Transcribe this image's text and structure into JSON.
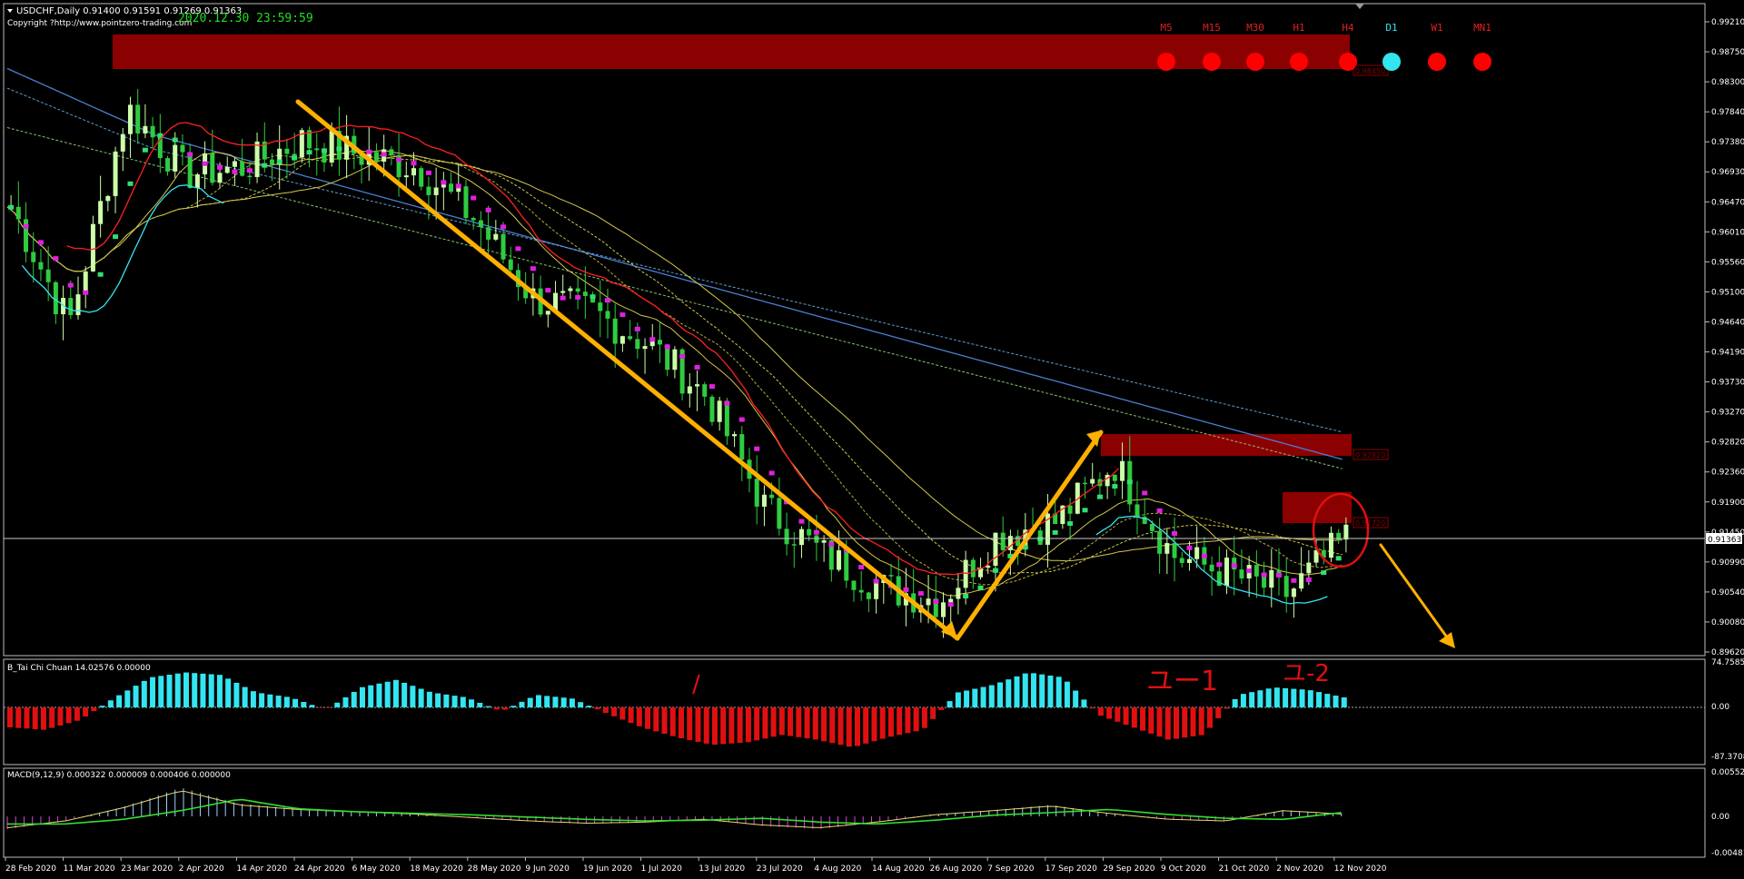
{
  "header": {
    "symbol_line": "USDCHF,Daily  0.91400 0.91591 0.91269 0.91363",
    "copyright": "Copyright ?http://www.pointzero-trading.com",
    "timestamp": "2020.12.30 23:59:59"
  },
  "timeframes": [
    {
      "label": "M5",
      "color": "#ff0000"
    },
    {
      "label": "M15",
      "color": "#ff0000"
    },
    {
      "label": "M30",
      "color": "#ff0000"
    },
    {
      "label": "H1",
      "color": "#ff0000"
    },
    {
      "label": "H4",
      "color": "#ff0000"
    },
    {
      "label": "D1",
      "color": "#33e5f0"
    },
    {
      "label": "W1",
      "color": "#ff0000"
    },
    {
      "label": "MN1",
      "color": "#ff0000"
    }
  ],
  "main_axis": {
    "ticks": [
      "0.99210",
      "0.98750",
      "0.98300",
      "0.97840",
      "0.97380",
      "0.96930",
      "0.96470",
      "0.96010",
      "0.95560",
      "0.95100",
      "0.94640",
      "0.94190",
      "0.93730",
      "0.93270",
      "0.92820",
      "0.92360",
      "0.91900",
      "0.91450",
      "0.90990",
      "0.90540",
      "0.90080",
      "0.89620"
    ],
    "current_price": "0.91363"
  },
  "box_labels": [
    "0.92820",
    "0.91720",
    "0.98450"
  ],
  "dates": [
    "28 Feb 2020",
    "11 Mar 2020",
    "23 Mar 2020",
    "2 Apr 2020",
    "14 Apr 2020",
    "24 Apr 2020",
    "6 May 2020",
    "18 May 2020",
    "28 May 2020",
    "9 Jun 2020",
    "19 Jun 2020",
    "1 Jul 2020",
    "13 Jul 2020",
    "23 Jul 2020",
    "4 Aug 2020",
    "14 Aug 2020",
    "26 Aug 2020",
    "7 Sep 2020",
    "17 Sep 2020",
    "29 Sep 2020",
    "9 Oct 2020",
    "21 Oct 2020",
    "2 Nov 2020",
    "12 Nov 2020"
  ],
  "indicator1": {
    "title": "B_Tai Chi Chuan 14.02576 0.00000",
    "ticks": [
      "74.75856",
      "0.00",
      "-87.37081"
    ],
    "annotations": [
      "/",
      "ユー1",
      "ユ-2"
    ]
  },
  "indicator2": {
    "title": "MACD(9,12,9) 0.000322 0.000009 0.000406 0.000000",
    "ticks": [
      "0.005528",
      "0.00",
      "-0.004814"
    ]
  },
  "colors": {
    "background": "#000000",
    "bull_candle": "#ccffaa",
    "bear_candle": "#2ecc40",
    "supply_zone": "#8b0000",
    "arrow": "#ffb000",
    "ma_blue": "#4a7fd0",
    "ma_yellow": "#d4c84a",
    "magenta": "#e020e0",
    "cyan": "#33e5f0",
    "hist_pos": "#33e5f0",
    "hist_neg": "#e01010"
  },
  "chart_data": [
    {
      "type": "candlestick",
      "title": "USDCHF,Daily",
      "ylim": [
        0.8962,
        0.9921
      ],
      "x": [
        "28 Feb 2020",
        "11 Mar 2020",
        "23 Mar 2020",
        "2 Apr 2020",
        "14 Apr 2020",
        "24 Apr 2020",
        "6 May 2020",
        "18 May 2020",
        "28 May 2020",
        "9 Jun 2020",
        "19 Jun 2020",
        "1 Jul 2020",
        "13 Jul 2020",
        "23 Jul 2020",
        "4 Aug 2020",
        "14 Aug 2020",
        "26 Aug 2020",
        "7 Sep 2020",
        "17 Sep 2020",
        "29 Sep 2020",
        "9 Oct 2020",
        "21 Oct 2020",
        "2 Nov 2020",
        "12 Nov 2020"
      ],
      "close_approx": [
        0.964,
        0.946,
        0.979,
        0.969,
        0.97,
        0.974,
        0.972,
        0.97,
        0.962,
        0.95,
        0.948,
        0.943,
        0.935,
        0.918,
        0.911,
        0.906,
        0.904,
        0.914,
        0.916,
        0.925,
        0.911,
        0.908,
        0.905,
        0.9136
      ],
      "zones": [
        [
          0.9852,
          0.9895
        ],
        [
          0.9262,
          0.93
        ],
        [
          0.915,
          0.919
        ]
      ],
      "current_price": 0.91363
    },
    {
      "type": "bar",
      "title": "B_Tai Chi Chuan 14.02576 0.00000",
      "ylim": [
        -87.37081,
        74.75856
      ],
      "series": [
        {
          "values": [
            -40,
            -45,
            -25,
            20,
            60,
            70,
            65,
            30,
            20,
            -5,
            40,
            55,
            30,
            20,
            -8,
            25,
            18,
            -12,
            -40,
            -60,
            -75,
            -70,
            -55,
            -65,
            -80,
            -60,
            -45,
            30,
            45,
            70,
            60,
            -15,
            -40,
            -65,
            -55,
            25,
            40,
            35,
            20
          ]
        }
      ]
    },
    {
      "type": "line",
      "title": "MACD(9,12,9) 0.000322 0.000009 0.000406 0.000000",
      "ylim": [
        -0.004814,
        0.005528
      ],
      "series": [
        {
          "values": [
            -0.002,
            -0.0008,
            0.0015,
            0.0045,
            0.002,
            0.0012,
            0.0008,
            0.0004,
            -0.0002,
            -0.0008,
            -0.0012,
            -0.001,
            -0.0005,
            -0.0015,
            -0.002,
            -0.001,
            0.0003,
            0.001,
            0.0018,
            0.0005,
            -0.0005,
            -0.0008,
            0.001,
            0.0004
          ]
        }
      ]
    }
  ]
}
